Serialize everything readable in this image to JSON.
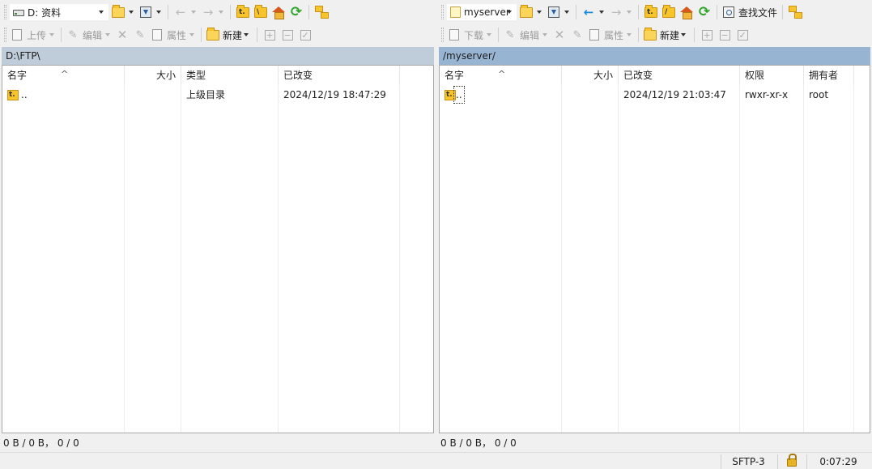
{
  "local": {
    "drive": "D: 资料",
    "toolbar": {
      "upload": "上传",
      "edit": "编辑",
      "properties": "属性",
      "new": "新建"
    },
    "path": "D:\\FTP\\",
    "columns": {
      "name": "名字",
      "size": "大小",
      "type": "类型",
      "modified": "已改变"
    },
    "rows": [
      {
        "name": "..",
        "size": "",
        "type": "上级目录",
        "modified": "2024/12/19 18:47:29"
      }
    ],
    "status": "0 B / 0 B， 0 / 0"
  },
  "remote": {
    "drive": "myserver",
    "toolbar": {
      "download": "下载",
      "edit": "编辑",
      "properties": "属性",
      "new": "新建",
      "find": "查找文件"
    },
    "path": "/myserver/",
    "columns": {
      "name": "名字",
      "size": "大小",
      "modified": "已改变",
      "rights": "权限",
      "owner": "拥有者"
    },
    "rows": [
      {
        "name": "..",
        "size": "",
        "modified": "2024/12/19 21:03:47",
        "rights": "rwxr-xr-x",
        "owner": "root"
      }
    ],
    "status": "0 B / 0 B， 0 / 0"
  },
  "statusbar": {
    "protocol": "SFTP-3",
    "elapsed": "0:07:29"
  },
  "icons": {
    "folder_parent_mark": "t.",
    "folder_color": "#f7c52b",
    "refresh": "⟳",
    "back": "←",
    "forward": "→",
    "close": "✕",
    "plus": "+",
    "minus": "−",
    "check": "✓",
    "pen": "✎",
    "sort": "^"
  },
  "colors": {
    "local_path_bg": "#bfcddb",
    "remote_path_bg": "#98b4d3"
  }
}
